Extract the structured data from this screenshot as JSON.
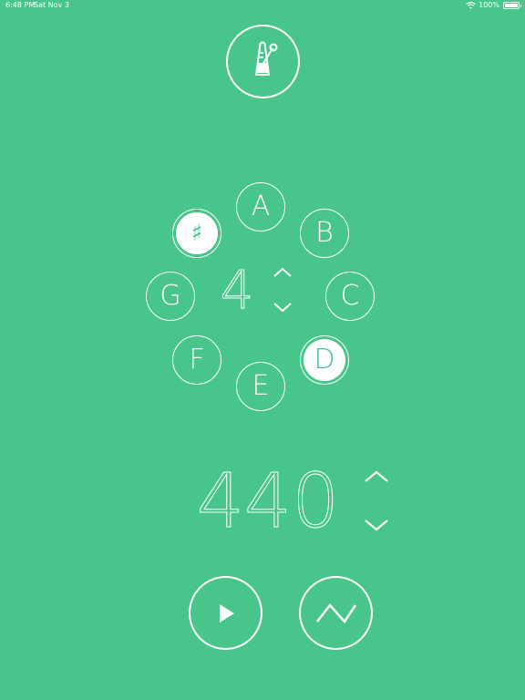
{
  "status_bar": {
    "time": "6:48 PM",
    "date": "Sat Nov 3",
    "battery": "100%",
    "icons": [
      "wifi-icon",
      "battery-icon"
    ]
  },
  "toolbar": {
    "metronome_icon": "metronome-icon"
  },
  "notes": {
    "sharp_label": "♯",
    "sharp_selected": true,
    "a": "A",
    "b": "B",
    "c": "C",
    "d": "D",
    "e": "E",
    "f": "F",
    "g": "G",
    "selected_note": "D"
  },
  "octave": {
    "value": "4",
    "up_icon": "chevron-up-icon",
    "down_icon": "chevron-down-icon"
  },
  "frequency": {
    "value": "440",
    "up_icon": "chevron-up-icon",
    "down_icon": "chevron-down-icon"
  },
  "controls": {
    "play_icon": "play-icon",
    "waveform_icon": "sawtooth-wave-icon"
  },
  "colors": {
    "background": "#47c58a",
    "foreground": "#ffffff"
  }
}
